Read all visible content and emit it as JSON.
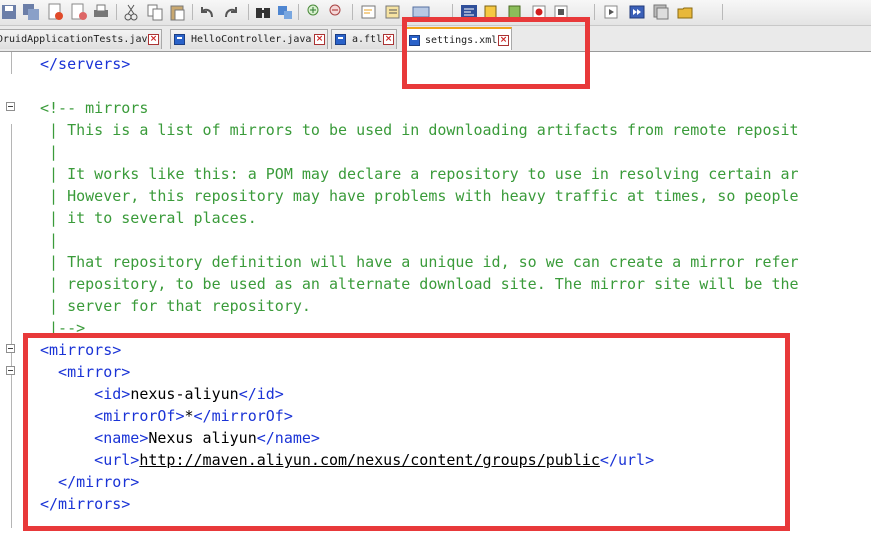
{
  "toolbar": {
    "icons": [
      "save-icon",
      "save-all-icon",
      "close-file-icon",
      "close-all-icon",
      "print-icon",
      "cut-icon",
      "copy-icon",
      "paste-icon",
      "undo-icon",
      "redo-icon",
      "find-icon",
      "replace-icon",
      "zoom-in-icon",
      "zoom-out-icon",
      "wrap-icon",
      "indent-icon",
      "show-whitespace-icon",
      "format-icon",
      "bookmark-icon",
      "comment-icon",
      "record-macro-icon",
      "stop-macro-icon",
      "play-macro-icon",
      "run-macro-multiple-icon",
      "save-macro-icon",
      "open-folder-icon"
    ]
  },
  "tabs": [
    {
      "label": "DruidApplicationTests.java",
      "active": false
    },
    {
      "label": "HelloController.java",
      "active": false
    },
    {
      "label": "a.ftl",
      "active": false
    },
    {
      "label": "settings.xml",
      "active": true
    }
  ],
  "colors": {
    "comment": "#3a9b3a",
    "tag": "#1a33d6",
    "text": "#000000",
    "highlight_box": "#e8393a",
    "active_tab_accent": "#f2a51b"
  },
  "editor": {
    "lines": [
      {
        "tokens": [
          {
            "t": "tag",
            "v": "</servers>"
          }
        ]
      },
      {
        "tokens": []
      },
      {
        "tokens": [
          {
            "t": "cmt",
            "v": "<!-- mirrors"
          }
        ]
      },
      {
        "tokens": [
          {
            "t": "cmt",
            "v": " | This is a list of mirrors to be used in downloading artifacts from remote reposit"
          }
        ]
      },
      {
        "tokens": [
          {
            "t": "cmt",
            "v": " |"
          }
        ]
      },
      {
        "tokens": [
          {
            "t": "cmt",
            "v": " | It works like this: a POM may declare a repository to use in resolving certain ar"
          }
        ]
      },
      {
        "tokens": [
          {
            "t": "cmt",
            "v": " | However, this repository may have problems with heavy traffic at times, so people"
          }
        ]
      },
      {
        "tokens": [
          {
            "t": "cmt",
            "v": " | it to several places."
          }
        ]
      },
      {
        "tokens": [
          {
            "t": "cmt",
            "v": " |"
          }
        ]
      },
      {
        "tokens": [
          {
            "t": "cmt",
            "v": " | That repository definition will have a unique id, so we can create a mirror refer"
          }
        ]
      },
      {
        "tokens": [
          {
            "t": "cmt",
            "v": " | repository, to be used as an alternate download site. The mirror site will be the"
          }
        ]
      },
      {
        "tokens": [
          {
            "t": "cmt",
            "v": " | server for that repository."
          }
        ]
      },
      {
        "tokens": [
          {
            "t": "cmt",
            "v": " |-->"
          }
        ]
      },
      {
        "tokens": [
          {
            "t": "tag",
            "v": "<mirrors>"
          }
        ]
      },
      {
        "tokens": [
          {
            "t": "tag",
            "v": "  <mirror>"
          }
        ]
      },
      {
        "tokens": [
          {
            "t": "tag",
            "v": "      <id>"
          },
          {
            "t": "txt",
            "v": "nexus-aliyun"
          },
          {
            "t": "tag",
            "v": "</id>"
          }
        ]
      },
      {
        "tokens": [
          {
            "t": "tag",
            "v": "      <mirrorOf>"
          },
          {
            "t": "txt",
            "v": "*"
          },
          {
            "t": "tag",
            "v": "</mirrorOf>"
          }
        ]
      },
      {
        "tokens": [
          {
            "t": "tag",
            "v": "      <name>"
          },
          {
            "t": "txt",
            "v": "Nexus aliyun"
          },
          {
            "t": "tag",
            "v": "</name>"
          }
        ]
      },
      {
        "tokens": [
          {
            "t": "tag",
            "v": "      <url>"
          },
          {
            "t": "url",
            "v": "http://maven.aliyun.com/nexus/content/groups/public"
          },
          {
            "t": "tag",
            "v": "</url>"
          }
        ]
      },
      {
        "tokens": [
          {
            "t": "tag",
            "v": "  </mirror>"
          }
        ]
      },
      {
        "tokens": [
          {
            "t": "tag",
            "v": "</mirrors>"
          }
        ]
      }
    ]
  }
}
